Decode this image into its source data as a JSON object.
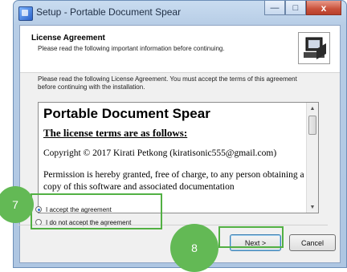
{
  "window": {
    "title": "Setup - Portable Document Spear",
    "icon": "setup-app-icon",
    "controls": {
      "minimize": "—",
      "maximize": "□",
      "close": "x"
    }
  },
  "header": {
    "title": "License Agreement",
    "subtitle": "Please read the following important information before continuing.",
    "logo_icon": "computer-setup-icon"
  },
  "intro_text": "Please read the following License Agreement. You must accept the terms of this agreement before continuing with the installation.",
  "license": {
    "heading": "Portable Document Spear",
    "terms_heading": "The license terms are as follows:",
    "copyright": "Copyright © 2017 Kirati Petkong (kiratisonic555@gmail.com)",
    "permission": "Permission is hereby granted, free of charge, to any person obtaining a copy of this software and associated documentation"
  },
  "options": [
    {
      "label": "I accept the agreement",
      "selected": true
    },
    {
      "label": "I do not accept the agreement",
      "selected": false
    }
  ],
  "buttons": {
    "next": "Next >",
    "cancel": "Cancel"
  },
  "annotations": {
    "first": "7",
    "second": "8",
    "color": "#52b043"
  }
}
